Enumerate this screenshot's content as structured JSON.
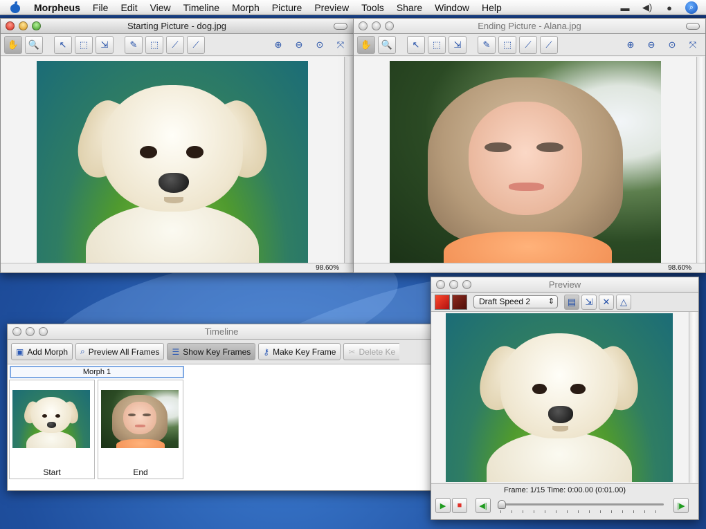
{
  "menubar": {
    "items": [
      "Morpheus",
      "File",
      "Edit",
      "View",
      "Timeline",
      "Morph",
      "Picture",
      "Preview",
      "Tools",
      "Share",
      "Window",
      "Help"
    ]
  },
  "start_window": {
    "title": "Starting Picture - dog.jpg",
    "zoom": "98.60%"
  },
  "end_window": {
    "title": "Ending Picture - Alana.jpg",
    "zoom": "98.60%"
  },
  "timeline": {
    "title": "Timeline",
    "buttons": {
      "add_morph": "Add Morph",
      "preview_all": "Preview All Frames",
      "show_key": "Show Key Frames",
      "make_key": "Make Key Frame",
      "delete_key": "Delete Ke"
    },
    "morph_label": "Morph 1",
    "frames": [
      {
        "label": "Start"
      },
      {
        "label": "End"
      }
    ]
  },
  "preview": {
    "title": "Preview",
    "speed": "Draft Speed 2",
    "frame_text": "Frame: 1/15  Time: 0:00.00 (0:01.00)",
    "progress": 0.0
  },
  "colors": {
    "accent": "#2b59b5",
    "desktop": "#1f4f9e",
    "swatch_start": "#d9221a",
    "swatch_end": "#7a1712"
  },
  "icons": [
    "apple-icon",
    "display-icon",
    "volume-icon",
    "user-icon",
    "spotlight-icon",
    "hand-icon",
    "magnify-icon",
    "select-arrow-icon",
    "select-box-icon",
    "move-points-icon",
    "add-point-icon",
    "marquee-icon",
    "edit-line-icon",
    "add-line-icon",
    "zoom-in-icon",
    "zoom-out-icon",
    "zoom-actual-icon",
    "zoom-fit-icon",
    "play-icon",
    "stop-icon",
    "step-back-icon",
    "step-forward-icon"
  ]
}
